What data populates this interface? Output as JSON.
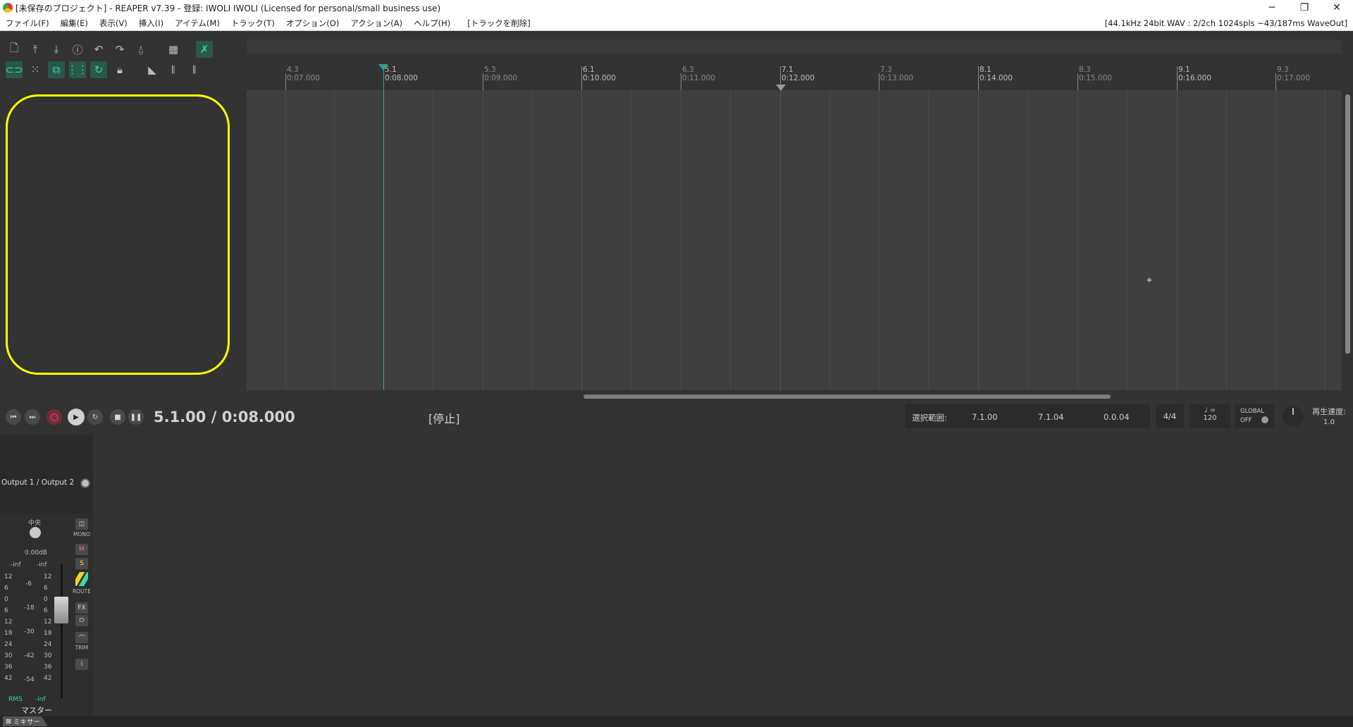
{
  "window": {
    "title": "[未保存のプロジェクト] - REAPER v7.39 - 登録: IWOLI IWOLI (Licensed for personal/small business use)",
    "controls": [
      "─",
      "❐",
      "✕"
    ]
  },
  "menu": {
    "items": [
      "ファイル(F)",
      "編集(E)",
      "表示(V)",
      "挿入(I)",
      "アイテム(M)",
      "トラック(T)",
      "オプション(O)",
      "アクション(A)",
      "ヘルプ(H)"
    ],
    "extra": "[トラックを削除]",
    "audio_status": "[44.1kHz 24bit WAV : 2/2ch 1024spls ~43/187ms WaveOut]"
  },
  "toolbar": {
    "row1_icons": [
      "new-project-icon",
      "open-project-icon",
      "save-project-icon",
      "project-settings-icon",
      "undo-icon",
      "redo-icon",
      "metronome-icon",
      "grid-icon",
      "ripple-icon"
    ],
    "row2_icons": [
      "link-icon",
      "grid-snap-icon",
      "envelope-link-icon",
      "grid-lines-icon",
      "loop-icon",
      "lock-icon",
      "item-tool-icon",
      "midi-icon",
      "piano-icon"
    ]
  },
  "ruler": {
    "marks": [
      {
        "bar": "4.3",
        "time": "0:07.000"
      },
      {
        "bar": "5.1",
        "time": "0:08.000"
      },
      {
        "bar": "5.3",
        "time": "0:09.000"
      },
      {
        "bar": "6.1",
        "time": "0:10.000"
      },
      {
        "bar": "6.3",
        "time": "0:11.000"
      },
      {
        "bar": "7.1",
        "time": "0:12.000"
      },
      {
        "bar": "7.3",
        "time": "0:13.000"
      },
      {
        "bar": "8.1",
        "time": "0:14.000"
      },
      {
        "bar": "8.3",
        "time": "0:15.000"
      },
      {
        "bar": "9.1",
        "time": "0:16.000"
      },
      {
        "bar": "9.3",
        "time": "0:17.000"
      }
    ]
  },
  "transport": {
    "position": "5.1.00 / 0:08.000",
    "state": "[停止]",
    "selection_label": "選択範囲:",
    "selection_start": "7.1.00",
    "selection_end": "7.1.04",
    "selection_length": "0.0.04",
    "time_signature": "4/4",
    "tempo_symbol": "♩ =",
    "tempo": "120",
    "global_label": "GLOBAL",
    "global_state": "OFF",
    "rate_label": "再生速度:",
    "rate_value": "1.0"
  },
  "mixer": {
    "master": {
      "output": "Output 1 / Output 2",
      "pan": "中央",
      "volume": "0.00dB",
      "peak_left": "-inf",
      "peak_right": "-inf",
      "scale_left": [
        "12",
        "6",
        "0",
        "6",
        "12",
        "18",
        "24",
        "30",
        "36",
        "42"
      ],
      "scale_mid": [
        "-6",
        "-18",
        "-30",
        "-42",
        "-54"
      ],
      "scale_right": [
        "12",
        "6",
        "0",
        "6",
        "12",
        "18",
        "24",
        "30",
        "36",
        "42"
      ],
      "buttons": {
        "mono": "MONO",
        "mute": "M",
        "solo": "S",
        "route": "ROUTE",
        "fx": "FX",
        "trim": "TRIM",
        "info": "i"
      },
      "rms_label": "RMS",
      "rms_value": "-inf",
      "name": "マスター"
    },
    "tab_label": "ミキサー"
  }
}
